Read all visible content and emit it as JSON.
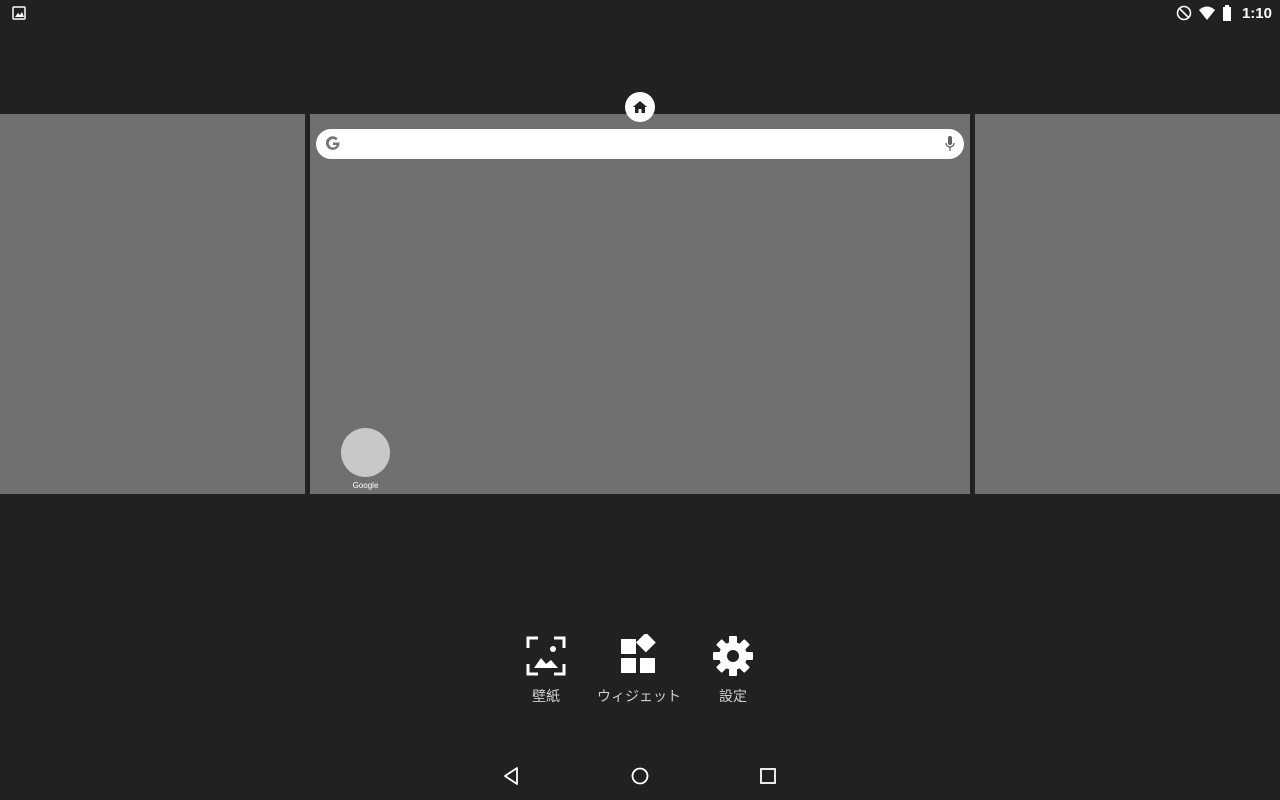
{
  "status_bar": {
    "left_icon": "image-notification-icon",
    "icons": [
      "do-not-disturb-icon",
      "wifi-icon",
      "battery-icon"
    ],
    "time": "1:10"
  },
  "workspace": {
    "home_indicator_icon": "home-icon",
    "search": {
      "logo_icon": "google-g-icon",
      "mic_icon": "mic-icon",
      "value": ""
    },
    "apps": [
      {
        "label": "Google"
      }
    ]
  },
  "options": [
    {
      "label": "壁紙",
      "icon": "wallpaper-icon"
    },
    {
      "label": "ウィジェット",
      "icon": "widgets-icon"
    },
    {
      "label": "設定",
      "icon": "settings-gear-icon"
    }
  ],
  "nav": {
    "back_icon": "back-triangle-icon",
    "home_icon": "home-circle-icon",
    "recents_icon": "recents-square-icon"
  },
  "colors": {
    "background": "#212121",
    "page": "#707070",
    "app_icon": "#c8c8c8",
    "label": "#cfcfcf"
  }
}
